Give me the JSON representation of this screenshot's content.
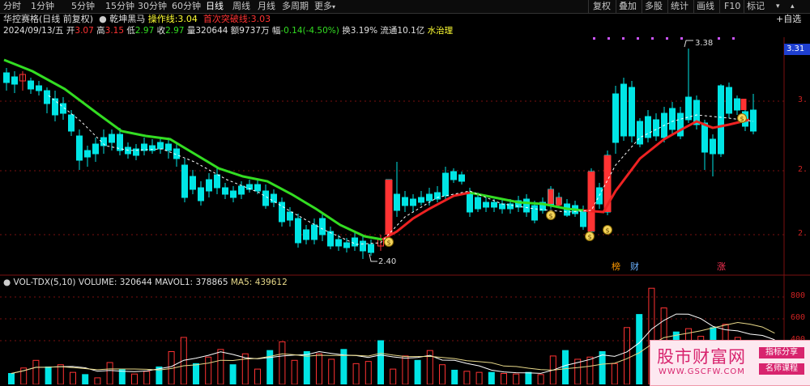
{
  "toolbar": {
    "periods": [
      "分时",
      "1分钟",
      "5分钟",
      "15分钟",
      "30分钟",
      "60分钟",
      "日线",
      "周线",
      "月线",
      "多周期",
      "更多"
    ],
    "active_period": "日线",
    "more_arrow": "▾",
    "right_buttons": [
      "复权",
      "叠加",
      "多股",
      "统计",
      "画线",
      "F10",
      "标记"
    ],
    "add_favorite": "+自选",
    "window_controls": [
      "▾",
      "▴"
    ]
  },
  "header": {
    "title": "华控赛格(日线 前复权)",
    "indicator_name": "乾坤黑马",
    "op_line_label": "操作线:",
    "op_line_value": "3.04",
    "breakout_label": "首次突破线:",
    "breakout_value": "3.03"
  },
  "quote": {
    "date": "2024/09/13/五",
    "open_label": "开",
    "open": "3.07",
    "high_label": "高",
    "high": "3.15",
    "low_label": "低",
    "low": "2.97",
    "close_label": "收",
    "close": "2.97",
    "volume_label": "量",
    "volume": "320644",
    "amount_label": "额",
    "amount": "9737万",
    "change_label": "幅",
    "change": "-0.14(-4.50%)",
    "turnover_label": "换",
    "turnover": "3.19%",
    "float_label": "流通",
    "float": "10.1亿",
    "sector": "水治理"
  },
  "chart_labels": {
    "high_marker": "3.38",
    "low_marker": "2.40",
    "current_price": "3.31",
    "event_1": "榜",
    "event_2": "财",
    "event_3": "涨",
    "signal_glyph": "$"
  },
  "price_axis": {
    "ticks": [
      "3.",
      "2.",
      "2."
    ]
  },
  "volume_header": {
    "name": "VOL-TDX(5,10)",
    "volume_label": "VOLUME:",
    "volume": "320644",
    "mavol1_label": "MAVOL1:",
    "mavol1": "378865",
    "ma5_label": "MA5:",
    "ma5": "439612"
  },
  "volume_axis": {
    "ticks": [
      "800",
      "600",
      "400"
    ]
  },
  "watermark": {
    "title": "股市财富网",
    "url": "WWW.GSCFW.COM",
    "tag1": "指标分享",
    "tag2": "名师课程"
  },
  "colors": {
    "up": "#ff3333",
    "down": "#00e5e5",
    "ma_green": "#33dd22",
    "ma_red": "#ee2222",
    "ma_white": "#ffffff",
    "ma_yellow": "#e8d98a",
    "grid": "#7a1010",
    "background": "#000000"
  },
  "chart_data": {
    "type": "candlestick",
    "price_range": [
      2.4,
      3.38
    ],
    "volume_ticks": [
      400,
      600,
      800
    ],
    "volume_values_k": [
      100,
      150,
      220,
      160,
      180,
      110,
      90,
      60,
      200,
      140,
      95,
      120,
      160,
      300,
      430,
      190,
      250,
      320,
      180,
      280,
      140,
      310,
      390,
      220,
      300,
      280,
      230,
      320,
      190,
      210,
      400,
      140,
      260,
      220,
      310,
      180,
      130,
      120,
      110,
      110,
      100,
      95,
      110,
      90,
      260,
      310,
      230,
      250,
      300,
      190,
      520,
      640,
      880,
      700,
      480,
      510,
      440,
      520,
      550,
      430,
      360,
      380,
      320
    ]
  }
}
